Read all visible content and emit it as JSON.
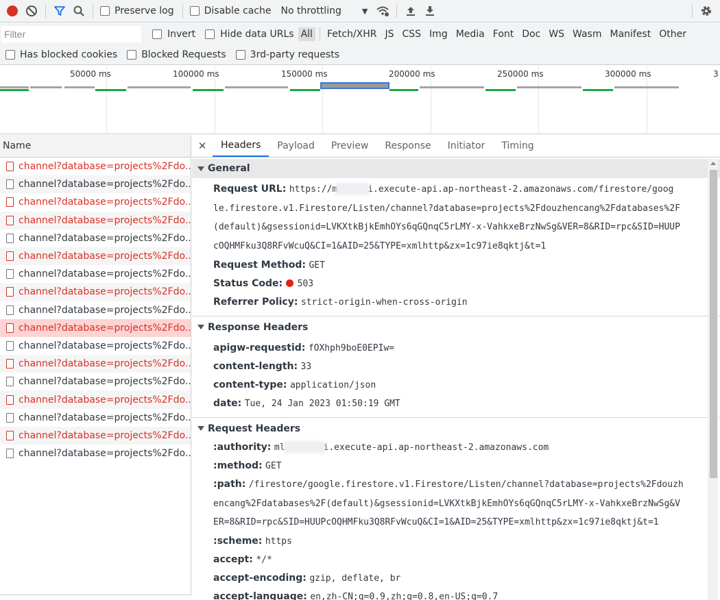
{
  "toolbar": {
    "preserve_log": "Preserve log",
    "disable_cache": "Disable cache",
    "throttling": "No throttling"
  },
  "filter": {
    "placeholder": "Filter",
    "invert": "Invert",
    "hide_data_urls": "Hide data URLs",
    "types": [
      "All",
      "Fetch/XHR",
      "JS",
      "CSS",
      "Img",
      "Media",
      "Font",
      "Doc",
      "WS",
      "Wasm",
      "Manifest",
      "Other"
    ],
    "active_type": "All"
  },
  "blocks": {
    "has_blocked_cookies": "Has blocked cookies",
    "blocked_requests": "Blocked Requests",
    "third_party": "3rd-party requests"
  },
  "overview": {
    "ticks": [
      "50000 ms",
      "100000 ms",
      "150000 ms",
      "200000 ms",
      "250000 ms",
      "300000 ms",
      "3"
    ]
  },
  "list": {
    "column": "Name",
    "rows": [
      {
        "name": "channel?database=projects%2Fdo...",
        "status": "error"
      },
      {
        "name": "channel?database=projects%2Fdo...",
        "status": "ok"
      },
      {
        "name": "channel?database=projects%2Fdo...",
        "status": "error"
      },
      {
        "name": "channel?database=projects%2Fdo...",
        "status": "error"
      },
      {
        "name": "channel?database=projects%2Fdo...",
        "status": "ok"
      },
      {
        "name": "channel?database=projects%2Fdo...",
        "status": "error"
      },
      {
        "name": "channel?database=projects%2Fdo...",
        "status": "ok"
      },
      {
        "name": "channel?database=projects%2Fdo...",
        "status": "error"
      },
      {
        "name": "channel?database=projects%2Fdo...",
        "status": "ok"
      },
      {
        "name": "channel?database=projects%2Fdo...",
        "status": "error",
        "selected": true
      },
      {
        "name": "channel?database=projects%2Fdo...",
        "status": "ok"
      },
      {
        "name": "channel?database=projects%2Fdo...",
        "status": "error"
      },
      {
        "name": "channel?database=projects%2Fdo...",
        "status": "ok"
      },
      {
        "name": "channel?database=projects%2Fdo...",
        "status": "error"
      },
      {
        "name": "channel?database=projects%2Fdo...",
        "status": "ok"
      },
      {
        "name": "channel?database=projects%2Fdo...",
        "status": "error"
      },
      {
        "name": "channel?database=projects%2Fdo...",
        "status": "ok"
      }
    ]
  },
  "details": {
    "close": "✕",
    "tabs": [
      "Headers",
      "Payload",
      "Preview",
      "Response",
      "Initiator",
      "Timing"
    ],
    "active_tab": "Headers",
    "general": {
      "title": "General",
      "request_url_key": "Request URL:",
      "request_url_prefix": "https://m",
      "request_url_lines": [
        "i.execute-api.ap-northeast-2.amazonaws.com/firestore/goog",
        "le.firestore.v1.Firestore/Listen/channel?database=projects%2Fdouzhencang%2Fdatabases%2F",
        "(default)&gsessionid=LVKXtkBjkEmhOYs6qGQnqC5rLMY-x-VahkxeBrzNwSg&VER=8&RID=rpc&SID=HUUP",
        "cOQHMFku3Q8RFvWcuQ&CI=1&AID=25&TYPE=xmlhttp&zx=1c97ie8qktj&t=1"
      ],
      "request_method_key": "Request Method:",
      "request_method": "GET",
      "status_code_key": "Status Code:",
      "status_code": "503",
      "referrer_policy_key": "Referrer Policy:",
      "referrer_policy": "strict-origin-when-cross-origin"
    },
    "response_headers": {
      "title": "Response Headers",
      "items": [
        {
          "k": "apigw-requestid:",
          "v": "fOXhph9boE0EPIw="
        },
        {
          "k": "content-length:",
          "v": "33"
        },
        {
          "k": "content-type:",
          "v": "application/json"
        },
        {
          "k": "date:",
          "v": "Tue, 24 Jan 2023 01:50:19 GMT"
        }
      ]
    },
    "request_headers": {
      "title": "Request Headers",
      "authority_key": ":authority:",
      "authority_prefix": "ml",
      "authority_suffix": "i.execute-api.ap-northeast-2.amazonaws.com",
      "method_key": ":method:",
      "method": "GET",
      "path_key": ":path:",
      "path_lines": [
        "/firestore/google.firestore.v1.Firestore/Listen/channel?database=projects%2Fdouzh",
        "encang%2Fdatabases%2F(default)&gsessionid=LVKXtkBjkEmhOYs6qGQnqC5rLMY-x-VahkxeBrzNwSg&V",
        "ER=8&RID=rpc&SID=HUUPcOQHMFku3Q8RFvWcuQ&CI=1&AID=25&TYPE=xmlhttp&zx=1c97ie8qktj&t=1"
      ],
      "scheme_key": ":scheme:",
      "scheme": "https",
      "accept_key": "accept:",
      "accept": "*/*",
      "accept_encoding_key": "accept-encoding:",
      "accept_encoding": "gzip, deflate, br",
      "accept_language_key": "accept-language:",
      "accept_language": "en,zh-CN;q=0.9,zh;q=0.8,en-US;q=0.7"
    }
  },
  "colors": {
    "error_text": "#d93025",
    "selected_row": "#fbd4d3",
    "tab_accent": "#1a73e8",
    "record_red": "#d93025",
    "filter_blue": "#1a73e8"
  }
}
